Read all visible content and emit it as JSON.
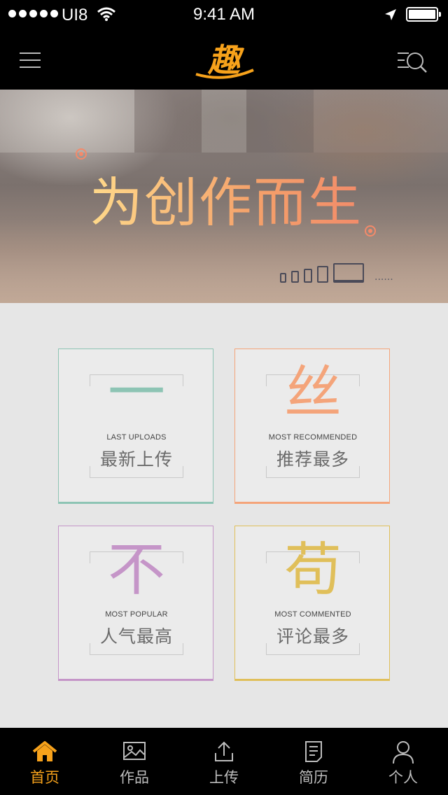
{
  "status_bar": {
    "carrier": "UI8",
    "time": "9:41 AM"
  },
  "nav": {
    "logo_text": "趣",
    "logo_color": "#f7a21b",
    "menu_icon": "hamburger-menu-icon",
    "search_icon": "list-search-icon"
  },
  "banner": {
    "title": "为创作而生",
    "accent": "#f48a6a"
  },
  "categories": [
    {
      "glyph": "一",
      "en": "LAST UPLOADS",
      "zh": "最新上传",
      "color": "#8dc4b4"
    },
    {
      "glyph": "丝",
      "en": "MOST RECOMMENDED",
      "zh": "推荐最多",
      "color": "#f4a47a"
    },
    {
      "glyph": "不",
      "en": "MOST POPULAR",
      "zh": "人气最高",
      "color": "#c595c8"
    },
    {
      "glyph": "苟",
      "en": "MOST COMMENTED",
      "zh": "评论最多",
      "color": "#e0bf5a"
    }
  ],
  "tabs": [
    {
      "label": "首页",
      "icon": "home-icon",
      "active": true
    },
    {
      "label": "作品",
      "icon": "image-icon",
      "active": false
    },
    {
      "label": "上传",
      "icon": "upload-icon",
      "active": false
    },
    {
      "label": "简历",
      "icon": "document-icon",
      "active": false
    },
    {
      "label": "个人",
      "icon": "user-icon",
      "active": false
    }
  ],
  "colors": {
    "active": "#f7a21b",
    "inactive": "#bdbdbd"
  }
}
